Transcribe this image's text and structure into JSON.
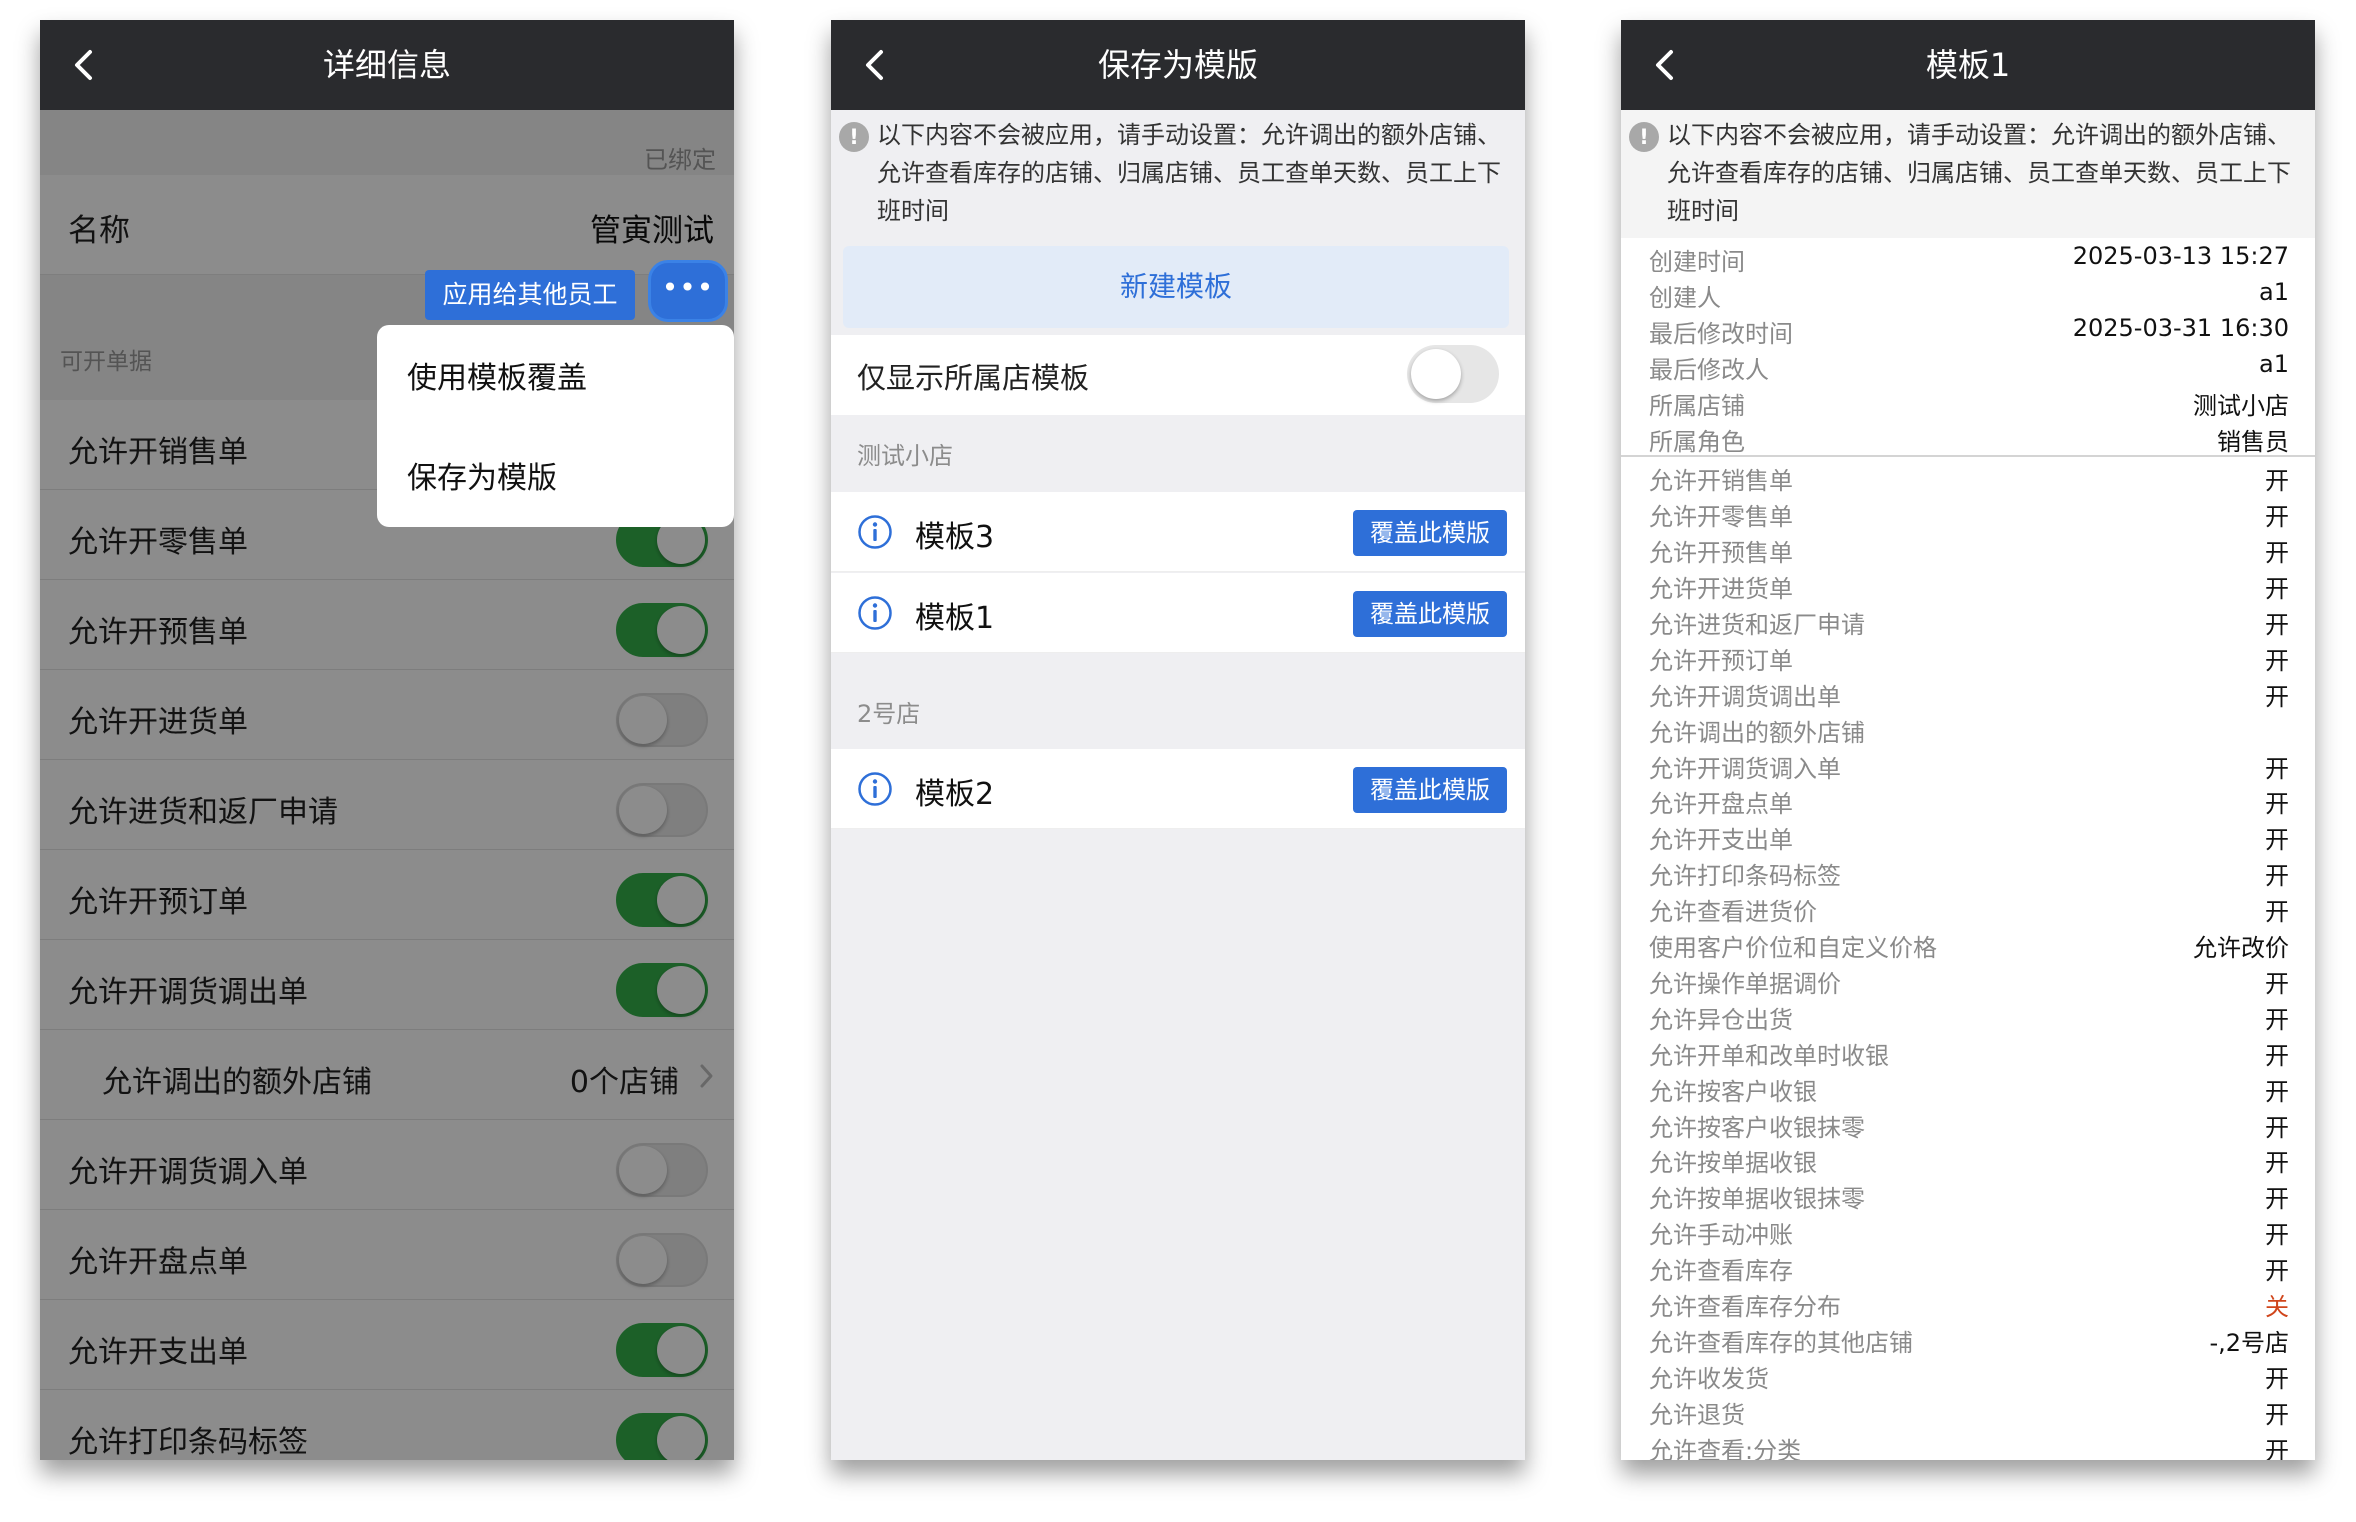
{
  "screen1": {
    "title": "详细信息",
    "bound_status": "已绑定",
    "name_label": "名称",
    "name_value": "管寅测试",
    "apply_button": "应用给其他员工",
    "more_button": "•••",
    "section_title": "可开单据",
    "permissions": [
      {
        "label": "允许开销售单",
        "on": true
      },
      {
        "label": "允许开零售单",
        "on": true
      },
      {
        "label": "允许开预售单",
        "on": true
      },
      {
        "label": "允许开进货单",
        "on": false
      },
      {
        "label": "允许进货和返厂申请",
        "on": false
      },
      {
        "label": "允许开预订单",
        "on": true
      },
      {
        "label": "允许开调货调出单",
        "on": true
      },
      {
        "label": "允许调出的额外店铺",
        "value": "0个店铺"
      },
      {
        "label": "允许开调货调入单",
        "on": false
      },
      {
        "label": "允许开盘点单",
        "on": false
      },
      {
        "label": "允许开支出单",
        "on": true
      },
      {
        "label": "允许打印条码标签",
        "on": true
      }
    ],
    "menu": {
      "item1": "使用模板覆盖",
      "item2": "保存为模版"
    },
    "colors": {
      "accent": "#2e6fd8",
      "toggle_on": "#34b04a",
      "navbar": "#2a2b2e"
    }
  },
  "screen2": {
    "title": "保存为模版",
    "notice": "以下内容不会被应用，请手动设置：允许调出的额外店铺、允许查看库存的店铺、归属店铺、员工查单天数、员工上下班时间",
    "new_template": "新建模板",
    "filter_label": "仅显示所属店模板",
    "filter_on": false,
    "groups": [
      {
        "title": "测试小店",
        "templates": [
          {
            "name": "模板3"
          },
          {
            "name": "模板1"
          }
        ]
      },
      {
        "title": "2号店",
        "templates": [
          {
            "name": "模板2"
          }
        ]
      }
    ],
    "cover_button": "覆盖此模版"
  },
  "screen3": {
    "title": "模板1",
    "notice": "以下内容不会被应用，请手动设置：允许调出的额外店铺、允许查看库存的店铺、归属店铺、员工查单天数、员工上下班时间",
    "meta": [
      {
        "label": "创建时间",
        "value": "2025-03-13 15:27"
      },
      {
        "label": "创建人",
        "value": "a1"
      },
      {
        "label": "最后修改时间",
        "value": "2025-03-31 16:30"
      },
      {
        "label": "最后修改人",
        "value": "a1"
      },
      {
        "label": "所属店铺",
        "value": "测试小店"
      },
      {
        "label": "所属角色",
        "value": "销售员"
      }
    ],
    "perms": [
      {
        "label": "允许开销售单",
        "value": "开"
      },
      {
        "label": "允许开零售单",
        "value": "开"
      },
      {
        "label": "允许开预售单",
        "value": "开"
      },
      {
        "label": "允许开进货单",
        "value": "开"
      },
      {
        "label": "允许进货和返厂申请",
        "value": "开"
      },
      {
        "label": "允许开预订单",
        "value": "开"
      },
      {
        "label": "允许开调货调出单",
        "value": "开"
      },
      {
        "label": "允许调出的额外店铺",
        "value": ""
      },
      {
        "label": "允许开调货调入单",
        "value": "开"
      },
      {
        "label": "允许开盘点单",
        "value": "开"
      },
      {
        "label": "允许开支出单",
        "value": "开"
      },
      {
        "label": "允许打印条码标签",
        "value": "开"
      },
      {
        "label": "允许查看进货价",
        "value": "开"
      },
      {
        "label": "使用客户价位和自定义价格",
        "value": "允许改价"
      },
      {
        "label": "允许操作单据调价",
        "value": "开"
      },
      {
        "label": "允许异仓出货",
        "value": "开"
      },
      {
        "label": "允许开单和改单时收银",
        "value": "开"
      },
      {
        "label": "允许按客户收银",
        "value": "开"
      },
      {
        "label": "允许按客户收银抹零",
        "value": "开"
      },
      {
        "label": "允许按单据收银",
        "value": "开"
      },
      {
        "label": "允许按单据收银抹零",
        "value": "开"
      },
      {
        "label": "允许手动冲账",
        "value": "开"
      },
      {
        "label": "允许查看库存",
        "value": "开"
      },
      {
        "label": "允许查看库存分布",
        "value": "关",
        "off": true
      },
      {
        "label": "允许查看库存的其他店铺",
        "value": "-,2号店"
      },
      {
        "label": "允许收发货",
        "value": "开"
      },
      {
        "label": "允许退货",
        "value": "开"
      },
      {
        "label": "允许查看:分类",
        "value": "开"
      }
    ]
  }
}
